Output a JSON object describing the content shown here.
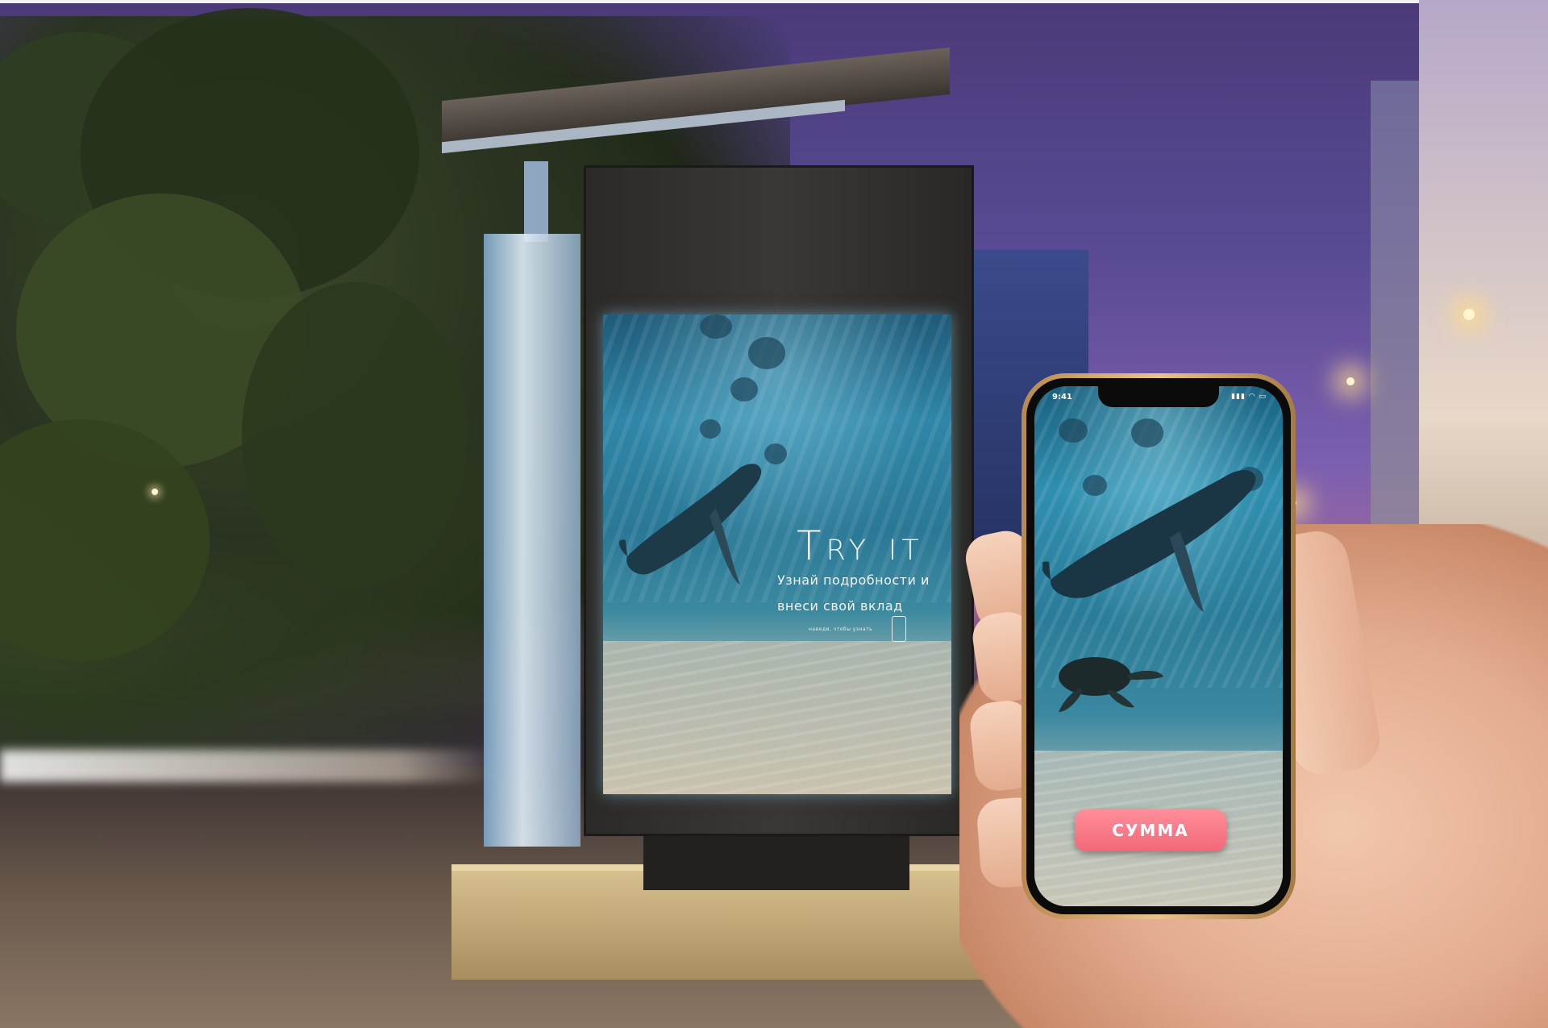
{
  "billboard": {
    "title": "Try it",
    "subtitle": "Узнай подробности и внеси свой вклад",
    "cta_small": "наведи, чтобы узнать",
    "icons": [
      "phone-outline-icon"
    ]
  },
  "phone": {
    "status_time": "9:41",
    "status_icons": "▮▮▮ ◠ ▭",
    "button_label": "СУММА",
    "button_color": "#f26878"
  },
  "colors": {
    "sky": "#5a4a95",
    "water": "#2f86a8",
    "phone_frame": "#e8c48c"
  }
}
